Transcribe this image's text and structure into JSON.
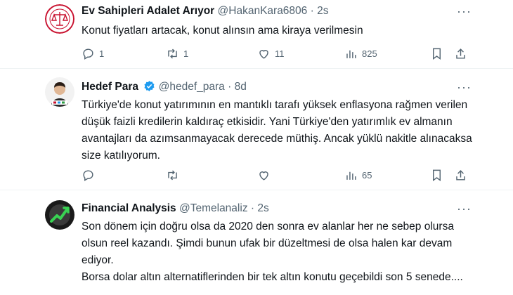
{
  "tweets": [
    {
      "name": "Ev Sahipleri Adalet Arıyor",
      "handle": "@HakanKara6806",
      "time": "2s",
      "text": "Konut fiyatları artacak, konut alınsın ama kiraya verilmesin",
      "replies": "1",
      "retweets": "1",
      "likes": "11",
      "views": "825",
      "verified": false
    },
    {
      "name": "Hedef Para",
      "handle": "@hedef_para",
      "time": "8d",
      "text": "Türkiye'de konut yatırımının en mantıklı tarafı yüksek enflasyona rağmen verilen düşük faizli kredilerin kaldıraç etkisidir. Yani Türkiye'den yatırımlık ev almanın avantajları da azımsanmayacak derecede müthiş. Ancak yüklü nakitle alınacaksa size katılıyorum.",
      "replies": "",
      "retweets": "",
      "likes": "",
      "views": "65",
      "verified": true
    },
    {
      "name": "Financial Analysis",
      "handle": "@Temelanaliz",
      "time": "2s",
      "text_lines": [
        "Son dönem için doğru olsa da 2020 den sonra ev alanlar her ne sebep olursa olsun reel kazandı. Şimdi bunun ufak bir düzeltmesi de olsa halen kar devam ediyor.",
        "Borsa dolar altın alternatiflerinden bir tek altın konutu geçebildi son 5 senede...."
      ],
      "verified": false
    }
  ],
  "separator": "·",
  "colors": {
    "text": "#0f1419",
    "muted": "#536471",
    "verified": "#1d9bf0",
    "divider": "#eff3f4"
  },
  "icons": [
    "reply-icon",
    "retweet-icon",
    "like-icon",
    "views-icon",
    "bookmark-icon",
    "share-icon",
    "more-icon",
    "verified-badge-icon"
  ]
}
